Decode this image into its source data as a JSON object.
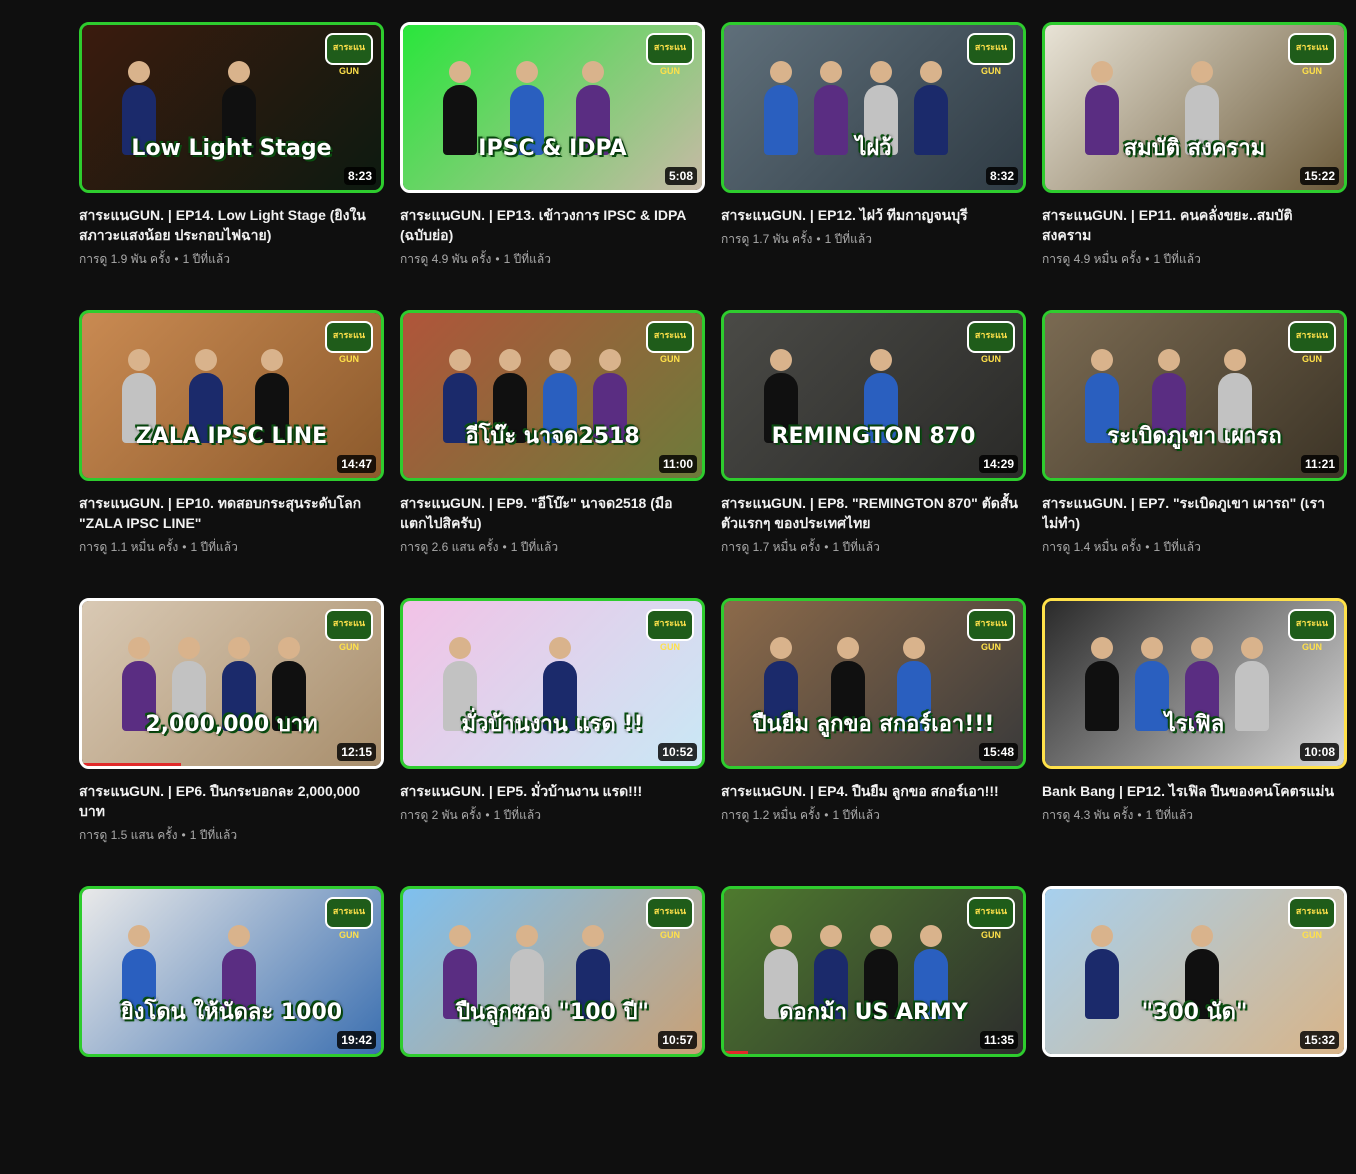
{
  "videos": [
    {
      "title": "สาระแนGUN. | EP14. Low Light Stage (ยิงในสภาวะแสงน้อย ประกอบไฟฉาย)",
      "views": "การดู 1.9 พัน ครั้ง",
      "age": "1 ปีที่แล้ว",
      "duration": "8:23",
      "overlay": "Low Light Stage",
      "bg1": "#3b1b0e",
      "bg2": "#0d1a10",
      "accent": "#2ecc2e",
      "progress": 0
    },
    {
      "title": "สาระแนGUN. | EP13. เข้าวงการ IPSC & IDPA (ฉบับย่อ)",
      "views": "การดู 4.9 พัน ครั้ง",
      "age": "1 ปีที่แล้ว",
      "duration": "5:08",
      "overlay": "IPSC & IDPA",
      "bg1": "#29e63b",
      "bg2": "#c8b9a6",
      "accent": "#ffffff",
      "progress": 0
    },
    {
      "title": "สาระแนGUN. | EP12. ไฝว้ ทีมกาญจนบุรี",
      "views": "การดู 1.7 พัน ครั้ง",
      "age": "1 ปีที่แล้ว",
      "duration": "8:32",
      "overlay": "ไฝว้",
      "bg1": "#5f6f7a",
      "bg2": "#2f3b44",
      "accent": "#2ecc2e",
      "progress": 0
    },
    {
      "title": "สาระแนGUN. | EP11. คนคลั่งขยะ..สมบัติสงคราม",
      "views": "การดู 4.9 หมื่น ครั้ง",
      "age": "1 ปีที่แล้ว",
      "duration": "15:22",
      "overlay": "สมบัติ สงคราม",
      "bg1": "#e8e3d6",
      "bg2": "#6b5a3a",
      "accent": "#2ecc2e",
      "progress": 0
    },
    {
      "title": "สาระแนGUN. | EP10. ทดสอบกระสุนระดับโลก \"ZALA IPSC LINE\"",
      "views": "การดู 1.1 หมื่น ครั้ง",
      "age": "1 ปีที่แล้ว",
      "duration": "14:47",
      "overlay": "ZALA IPSC LINE",
      "bg1": "#c98a52",
      "bg2": "#8c5a2c",
      "accent": "#2ecc2e",
      "progress": 0
    },
    {
      "title": "สาระแนGUN. | EP9. \"อีโบ๊ะ\" นาจด2518 (มือแตกไปสิครับ)",
      "views": "การดู 2.6 แสน ครั้ง",
      "age": "1 ปีที่แล้ว",
      "duration": "11:00",
      "overlay": "อีโบ๊ะ นาจด2518",
      "bg1": "#b0553a",
      "bg2": "#6d7b3a",
      "accent": "#2ecc2e",
      "progress": 0
    },
    {
      "title": "สาระแนGUN. | EP8. \"REMINGTON 870\" ตัดสั้นตัวแรกๆ ของประเทศไทย",
      "views": "การดู 1.7 หมื่น ครั้ง",
      "age": "1 ปีที่แล้ว",
      "duration": "14:29",
      "overlay": "REMINGTON 870",
      "bg1": "#4a4a46",
      "bg2": "#2a2a28",
      "accent": "#2ecc2e",
      "progress": 0
    },
    {
      "title": "สาระแนGUN. | EP7. \"ระเบิดภูเขา เผารถ\" (เราไม่ทำ)",
      "views": "การดู 1.4 หมื่น ครั้ง",
      "age": "1 ปีที่แล้ว",
      "duration": "11:21",
      "overlay": "ระเบิดภูเขา เผารถ",
      "bg1": "#7a6a52",
      "bg2": "#3c3426",
      "accent": "#2ecc2e",
      "progress": 0
    },
    {
      "title": "สาระแนGUN. | EP6. ปืนกระบอกละ 2,000,000 บาท",
      "views": "การดู 1.5 แสน ครั้ง",
      "age": "1 ปีที่แล้ว",
      "duration": "12:15",
      "overlay": "2,000,000 บาท",
      "bg1": "#d9c9b4",
      "bg2": "#a88e6c",
      "accent": "#ffffff",
      "progress": 0.33
    },
    {
      "title": "สาระแนGUN. | EP5. มั่วบ้านงาน แรด!!!",
      "views": "การดู 2 พัน ครั้ง",
      "age": "1 ปีที่แล้ว",
      "duration": "10:52",
      "overlay": "มั่วบ้านงาน แรด !!",
      "bg1": "#f2c2e6",
      "bg2": "#c9e8f5",
      "accent": "#2ecc2e",
      "progress": 0
    },
    {
      "title": "สาระแนGUN. | EP4. ปืนยืม ลูกขอ สกอร์เอา!!!",
      "views": "การดู 1.2 หมื่น ครั้ง",
      "age": "1 ปีที่แล้ว",
      "duration": "15:48",
      "overlay": "ปืนยืม ลูกขอ สกอร์เอา!!!",
      "bg1": "#8c6a4a",
      "bg2": "#3a3a3a",
      "accent": "#2ecc2e",
      "progress": 0
    },
    {
      "title": "Bank Bang | EP12. ไรเฟิล ปืนของคนโคตรแม่น",
      "views": "การดู 4.3 พัน ครั้ง",
      "age": "1 ปีที่แล้ว",
      "duration": "10:08",
      "overlay": "ไรเฟิล",
      "bg1": "#2a2a2a",
      "bg2": "#d8d8d8",
      "accent": "#ffe14a",
      "progress": 0
    },
    {
      "title": "",
      "views": "",
      "age": "",
      "duration": "19:42",
      "overlay": "ยิงโดน ให้นัดละ 1000",
      "bg1": "#e9e9e9",
      "bg2": "#3b6fb0",
      "accent": "#2ecc2e",
      "progress": 0
    },
    {
      "title": "",
      "views": "",
      "age": "",
      "duration": "10:57",
      "overlay": "ปืนลูกซอง \"100 ปี\"",
      "bg1": "#7ec0ef",
      "bg2": "#c9a176",
      "accent": "#2ecc2e",
      "progress": 0
    },
    {
      "title": "",
      "views": "",
      "age": "",
      "duration": "11:35",
      "overlay": "ดอกม้า US ARMY",
      "bg1": "#4e7a2e",
      "bg2": "#2d2d2d",
      "accent": "#2ecc2e",
      "progress": 0.08
    },
    {
      "title": "",
      "views": "",
      "age": "",
      "duration": "15:32",
      "overlay": "\"300 นัด\"",
      "bg1": "#a7d0ee",
      "bg2": "#d8b488",
      "accent": "#ffffff",
      "progress": 0
    }
  ],
  "logo_text": "สาระแน GUN",
  "separator": "•"
}
